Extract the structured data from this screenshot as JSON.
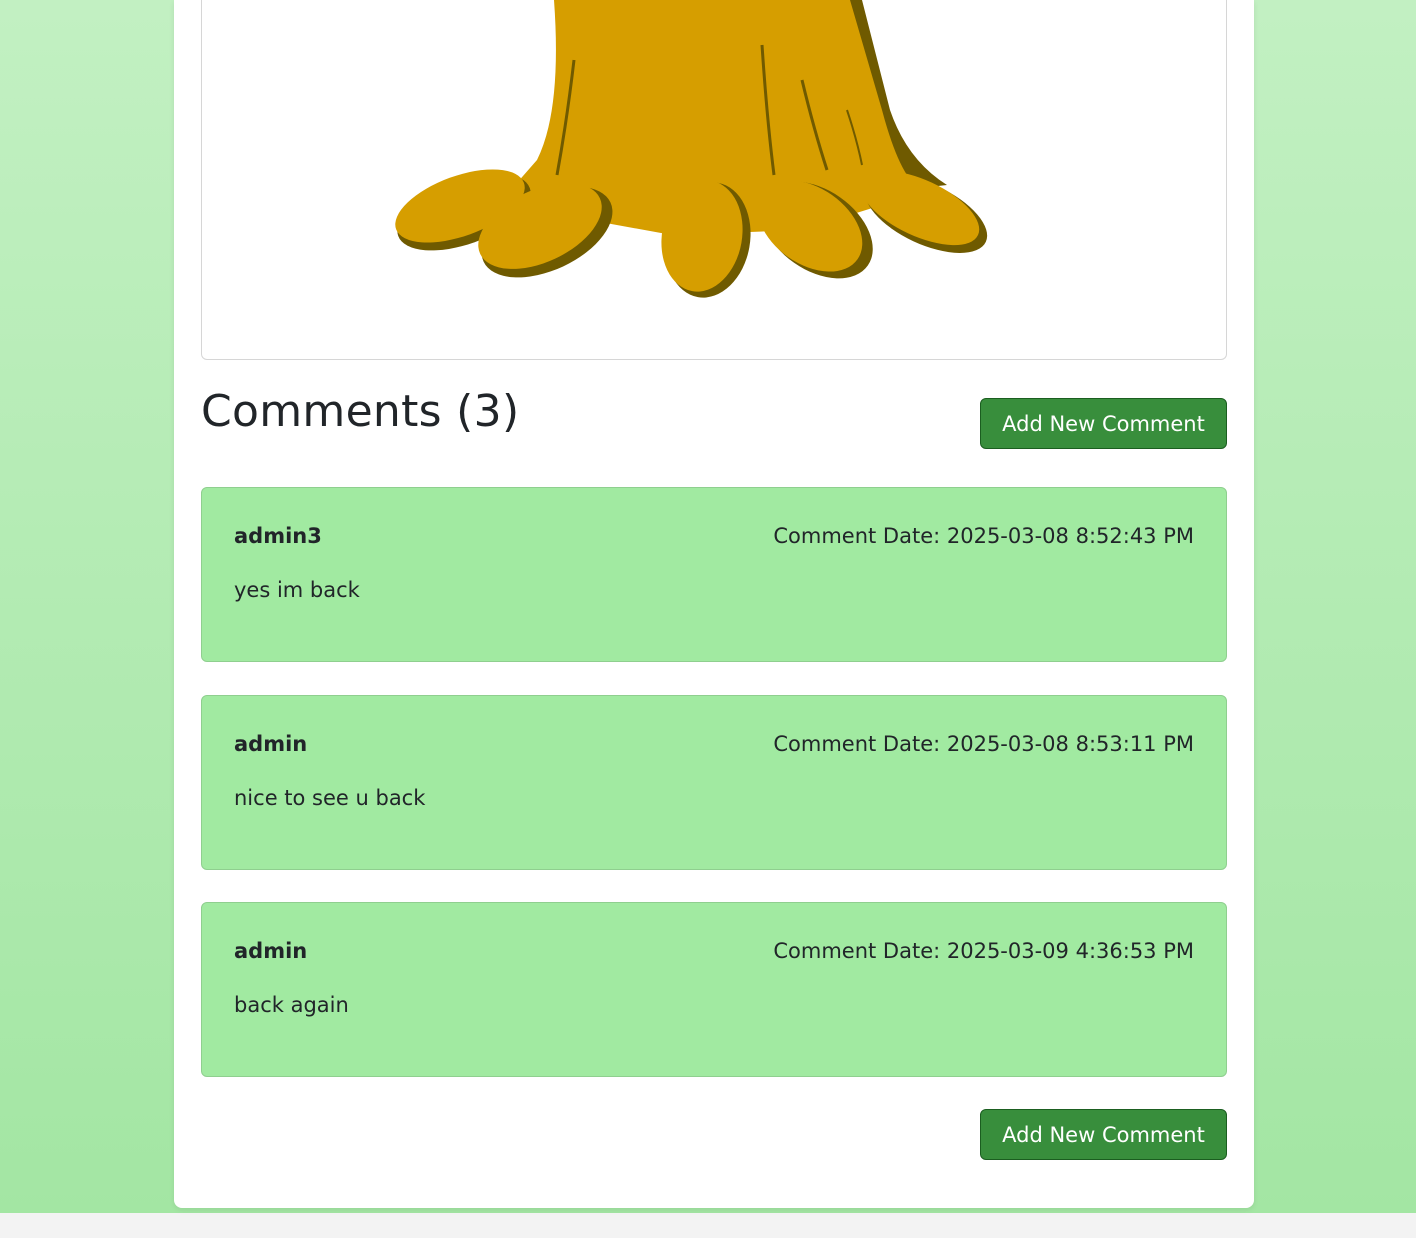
{
  "comments_section": {
    "title": "Comments (3)",
    "add_button_label": "Add New Comment",
    "add_button_bottom_label": "Add New Comment"
  },
  "comments": [
    {
      "author": "admin3",
      "date": "Comment Date: 2025-03-08 8:52:43 PM",
      "text": "yes im back"
    },
    {
      "author": "admin",
      "date": "Comment Date: 2025-03-08 8:53:11 PM",
      "text": "nice to see u back"
    },
    {
      "author": "admin",
      "date": "Comment Date: 2025-03-09 4:36:53 PM",
      "text": "back again"
    }
  ],
  "colors": {
    "page_bg_top": "#c2f0c2",
    "page_bg_bottom": "#a3e6a3",
    "comment_bg": "#a1eaa1",
    "button_bg": "#388e3c",
    "tree_fill": "#d69e00",
    "tree_shadow": "#6f5a00"
  },
  "image": {
    "icon": "tree-stump-icon"
  }
}
